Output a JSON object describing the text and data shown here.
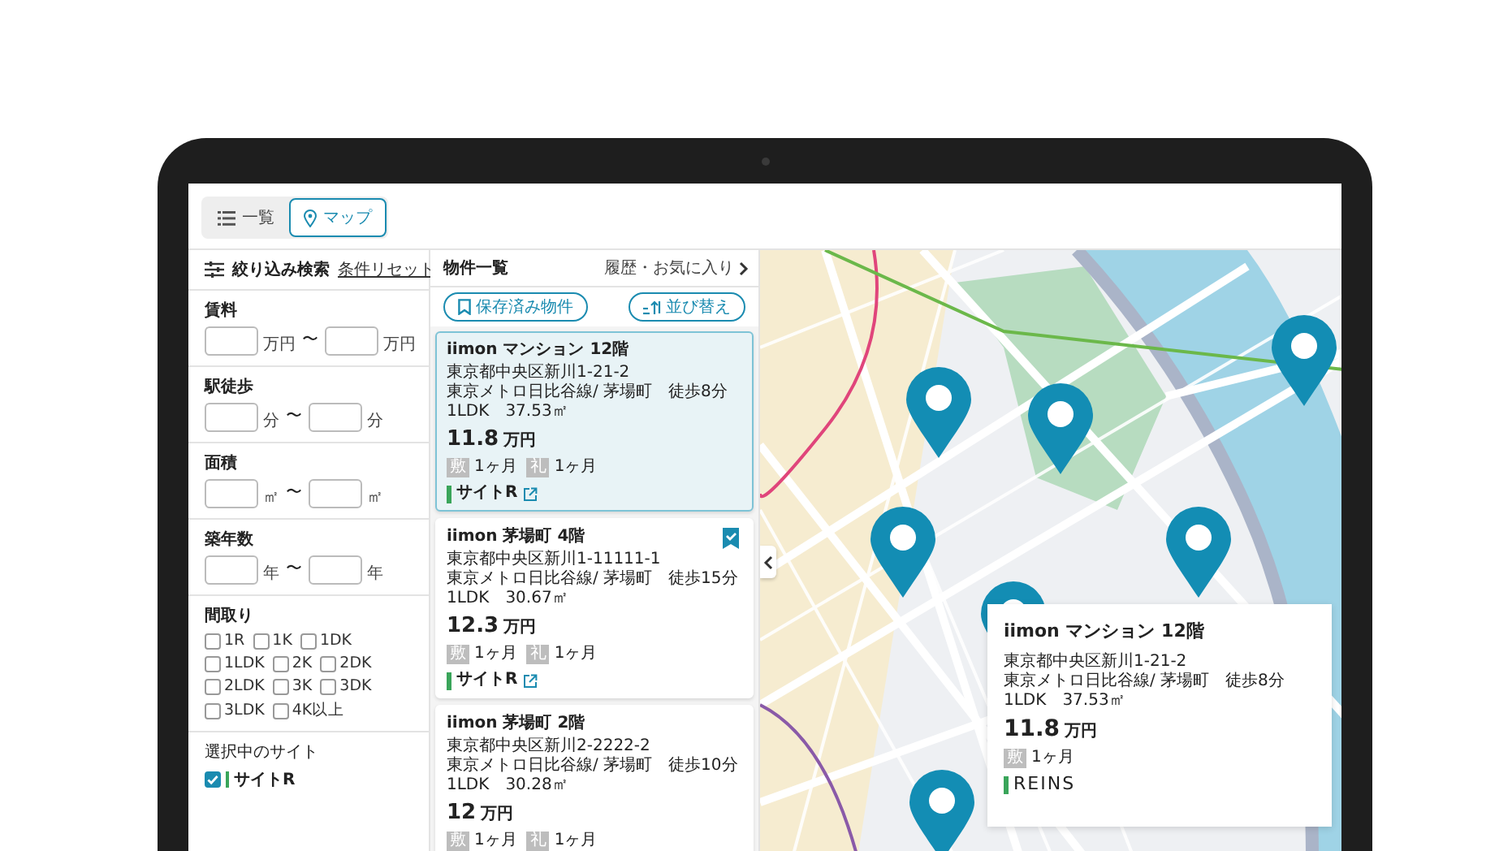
{
  "view_tabs": [
    {
      "label": "一覧",
      "kind": "list",
      "selected": false
    },
    {
      "label": "マップ",
      "kind": "map",
      "selected": true
    }
  ],
  "filter": {
    "title": "絞り込み検索",
    "reset": "条件リセット",
    "ranges": [
      {
        "label": "賃料",
        "unit_min": "万円",
        "unit_max": "万円"
      },
      {
        "label": "駅徒歩",
        "unit_min": "分",
        "unit_max": "分"
      },
      {
        "label": "面積",
        "unit_min": "㎡",
        "unit_max": "㎡"
      },
      {
        "label": "築年数",
        "unit_min": "年",
        "unit_max": "年"
      }
    ],
    "range_sep": "〜",
    "layout": {
      "label": "間取り",
      "options": [
        {
          "label": "1R",
          "checked": false
        },
        {
          "label": "1K",
          "checked": false
        },
        {
          "label": "1DK",
          "checked": false
        },
        {
          "label": "1LDK",
          "checked": false
        },
        {
          "label": "2K",
          "checked": false
        },
        {
          "label": "2DK",
          "checked": false
        },
        {
          "label": "2LDK",
          "checked": false
        },
        {
          "label": "3K",
          "checked": false
        },
        {
          "label": "3DK",
          "checked": false
        },
        {
          "label": "3LDK",
          "checked": false
        },
        {
          "label": "4K以上",
          "checked": false
        }
      ]
    },
    "sites": {
      "label": "選択中のサイト",
      "items": [
        {
          "label": "サイトR",
          "checked": true,
          "color": "#3aa55a"
        }
      ]
    }
  },
  "list": {
    "title": "物件一覧",
    "history_link": "履歴・お気に入り",
    "saved_button": "保存済み物件",
    "sort_button": "並び替え",
    "properties": [
      {
        "name": "iimon マンション 12階",
        "address": "東京都中央区新川1-21-2",
        "access": "東京メトロ日比谷線/ 茅場町　徒歩8分",
        "layout_area": "1LDK　37.53㎡",
        "price": "11.8",
        "price_unit": "万円",
        "deposit_label": "敷",
        "deposit": "1ヶ月",
        "key_money_label": "礼",
        "key_money": "1ヶ月",
        "site": {
          "label": "サイトR",
          "color": "#3aa55a"
        },
        "selected": true,
        "bookmarked": false
      },
      {
        "name": "iimon 茅場町 4階",
        "address": "東京都中央区新川1-11111-1",
        "access": "東京メトロ日比谷線/ 茅場町　徒歩15分",
        "layout_area": "1LDK　30.67㎡",
        "price": "12.3",
        "price_unit": "万円",
        "deposit_label": "敷",
        "deposit": "1ヶ月",
        "key_money_label": "礼",
        "key_money": "1ヶ月",
        "site": {
          "label": "サイトR",
          "color": "#3aa55a"
        },
        "selected": false,
        "bookmarked": true
      },
      {
        "name": "iimon 茅場町 2階",
        "address": "東京都中央区新川2-2222-2",
        "access": "東京メトロ日比谷線/ 茅場町　徒歩10分",
        "layout_area": "1LDK　30.28㎡",
        "price": "12",
        "price_unit": "万円",
        "deposit_label": "敷",
        "deposit": "1ヶ月",
        "key_money_label": "礼",
        "key_money": "1ヶ月",
        "selected": false,
        "bookmarked": false
      }
    ]
  },
  "map": {
    "popup": {
      "name": "iimon マンション 12階",
      "address": "東京都中央区新川1-21-2",
      "access": "東京メトロ日比谷線/ 茅場町　徒歩8分",
      "layout_area": "1LDK　37.53㎡",
      "price": "11.8",
      "price_unit": "万円",
      "deposit_label": "敷",
      "deposit": "1ヶ月",
      "site": {
        "label": "REINS",
        "color": "#3aa55a"
      }
    }
  }
}
